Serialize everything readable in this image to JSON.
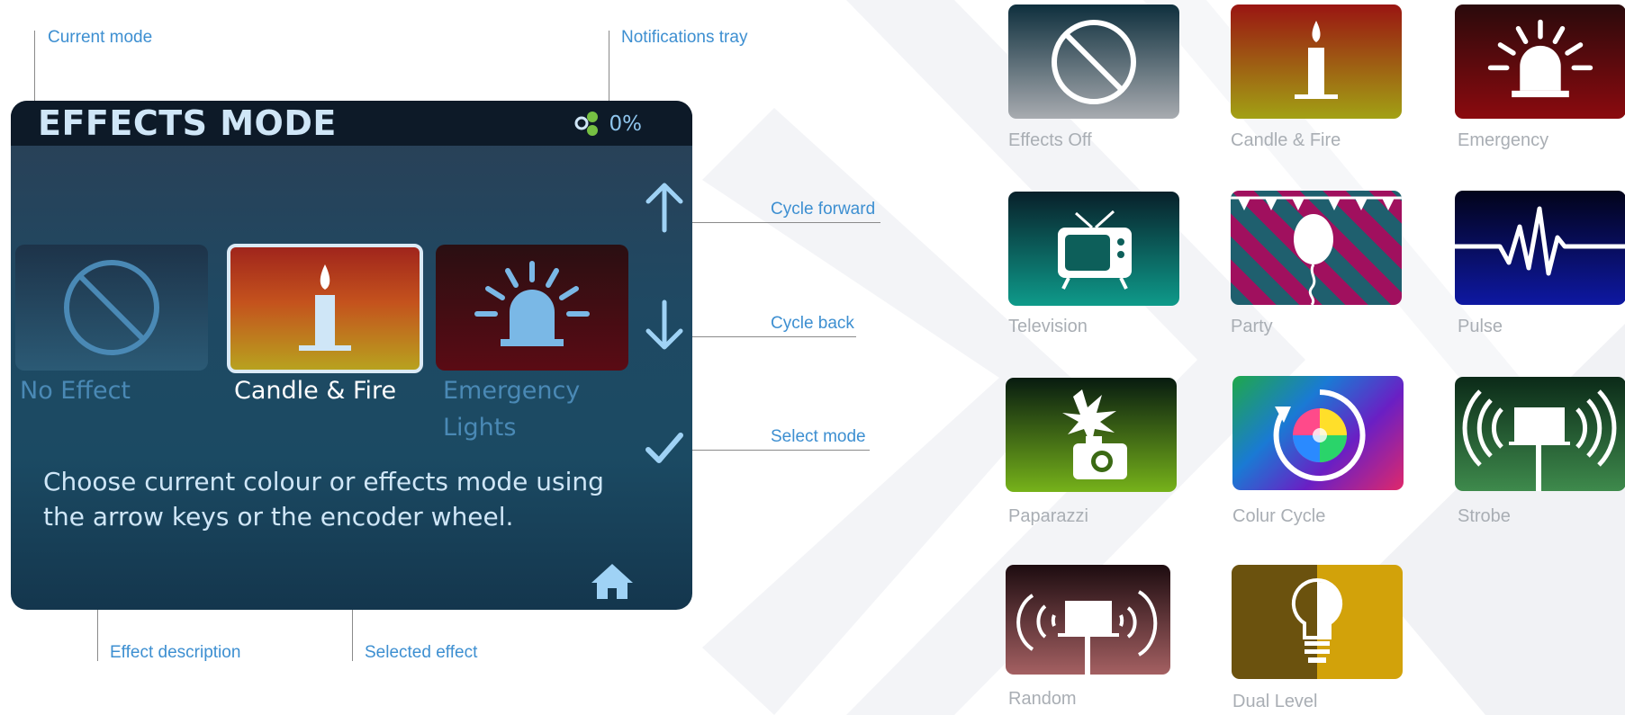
{
  "callouts": {
    "current_mode": "Current mode",
    "notifications_tray": "Notifications tray",
    "cycle_forward": "Cycle forward",
    "cycle_back": "Cycle back",
    "select_mode": "Select mode",
    "effect_description": "Effect description",
    "selected_effect": "Selected effect"
  },
  "screen": {
    "title": "EFFECTS MODE",
    "notification_value": "0%",
    "tiles": [
      {
        "label": "No Effect",
        "icon": "no-symbol-icon",
        "state": "dim"
      },
      {
        "label": "Candle & Fire",
        "icon": "candle-icon",
        "state": "selected"
      },
      {
        "label_line1": "Emergency",
        "label_line2": "Lights",
        "icon": "siren-icon",
        "state": "dim"
      }
    ],
    "description_line1": "Choose current colour or effects mode using",
    "description_line2": "the arrow keys or the encoder wheel.",
    "buttons": [
      "arrow-up-icon",
      "arrow-down-icon",
      "checkmark-icon",
      "home-icon"
    ]
  },
  "gallery": {
    "items": [
      {
        "label": "Effects Off",
        "icon": "no-symbol-icon"
      },
      {
        "label": "Candle & Fire",
        "icon": "candle-icon"
      },
      {
        "label": "Emergency",
        "icon": "siren-icon"
      },
      {
        "label": "Television",
        "icon": "tv-icon"
      },
      {
        "label": "Party",
        "icon": "balloon-icon"
      },
      {
        "label": "Pulse",
        "icon": "pulse-icon"
      },
      {
        "label": "Paparazzi",
        "icon": "camera-flash-icon"
      },
      {
        "label": "Colur Cycle",
        "icon": "color-wheel-icon"
      },
      {
        "label": "Strobe",
        "icon": "strobe-icon"
      },
      {
        "label": "Random",
        "icon": "random-icon"
      },
      {
        "label": "Dual Level",
        "icon": "bulb-icon"
      }
    ]
  },
  "colors": {
    "accent": "#3d8fd1",
    "screen_header": "#0d1a28",
    "screen_text": "#cfe6f7",
    "gallery_label": "#a9aeb4"
  }
}
